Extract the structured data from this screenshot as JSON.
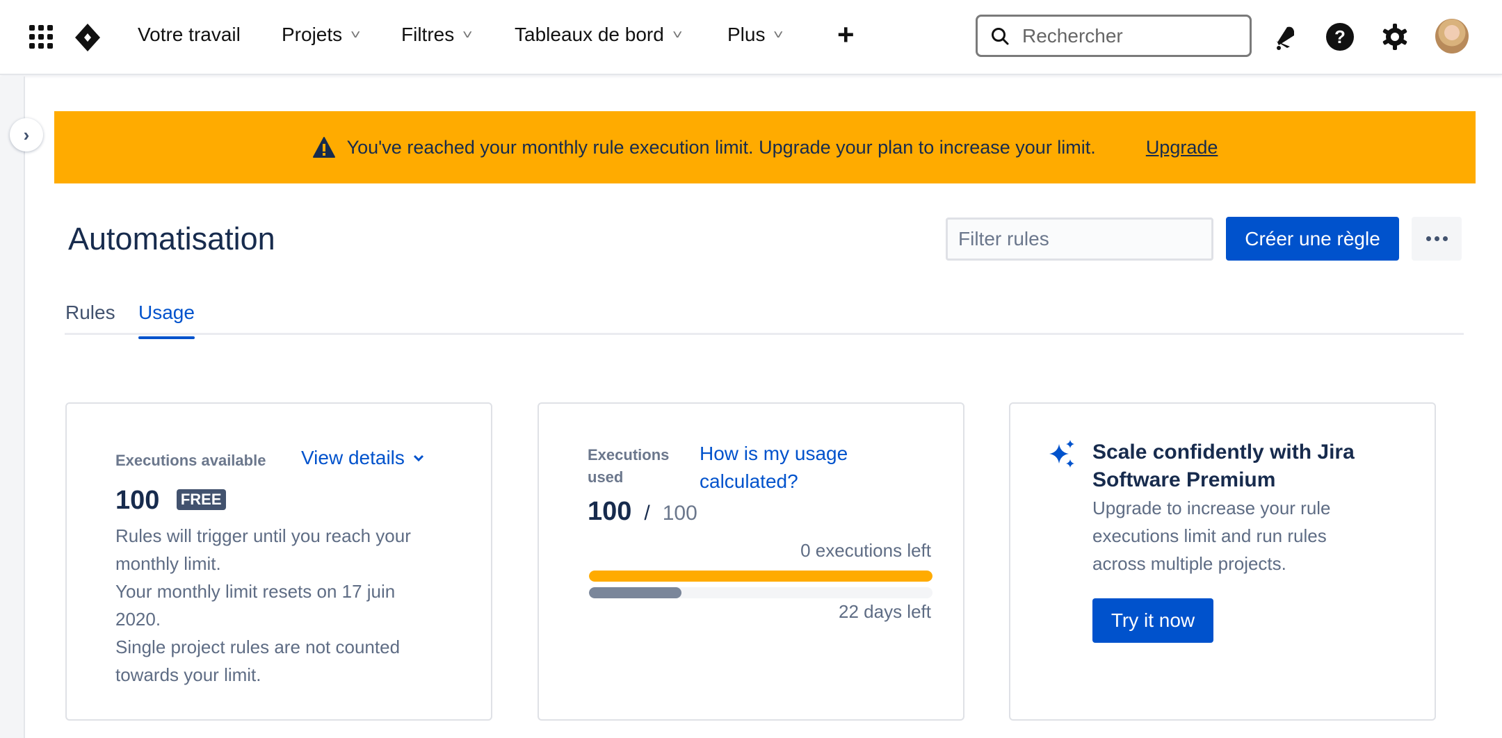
{
  "nav": {
    "items": [
      {
        "label": "Votre travail",
        "has_dropdown": false
      },
      {
        "label": "Projets",
        "has_dropdown": true
      },
      {
        "label": "Filtres",
        "has_dropdown": true
      },
      {
        "label": "Tableaux de bord",
        "has_dropdown": true
      },
      {
        "label": "Plus",
        "has_dropdown": true
      }
    ],
    "create_icon": "+",
    "search_placeholder": "Rechercher",
    "icons": [
      "apps-grid-icon",
      "jira-logo",
      "notifications-icon",
      "help-icon",
      "settings-icon",
      "avatar"
    ]
  },
  "banner": {
    "message": "You've reached your monthly rule execution limit. Upgrade your plan to increase your limit.",
    "action": "Upgrade",
    "color": "#ffab00"
  },
  "page": {
    "title": "Automatisation",
    "filter_placeholder": "Filter rules",
    "create_label": "Créer une règle"
  },
  "tabs": [
    {
      "label": "Rules",
      "active": false
    },
    {
      "label": "Usage",
      "active": true
    }
  ],
  "cards": {
    "available": {
      "label": "Executions available",
      "link": "View details",
      "value": "100",
      "badge": "FREE",
      "lines": [
        "Rules will trigger until you reach your monthly limit.",
        "Your monthly limit resets on 17 juin 2020.",
        "Single project rules are not counted towards your limit."
      ]
    },
    "used": {
      "label": "Executions used",
      "link": "How is my usage calculated?",
      "used": "100",
      "separator": "/",
      "total": "100",
      "executions_left": "0 executions left",
      "days_left": "22 days left",
      "executions_progress": 1.0,
      "time_progress": 0.27,
      "colors": {
        "executions": "#ffab00",
        "time": "#7a869a"
      }
    },
    "premium": {
      "title": "Scale confidently with Jira Software Premium",
      "description": "Upgrade to increase your rule executions limit and run rules across multiple projects.",
      "button": "Try it now"
    }
  },
  "colors": {
    "brand": "#0052cc",
    "text": "#172b4d",
    "subtle": "#5e6c84"
  }
}
